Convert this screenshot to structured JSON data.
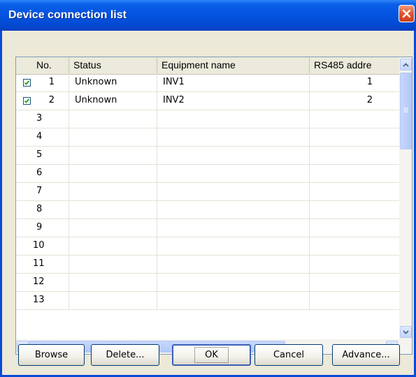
{
  "window": {
    "title": "Device connection list"
  },
  "table": {
    "columns": [
      "No.",
      "Status",
      "Equipment name",
      "RS485 addre"
    ],
    "rows": [
      {
        "no": "1",
        "checked": true,
        "status": "Unknown",
        "name": "INV1",
        "address": "1"
      },
      {
        "no": "2",
        "checked": true,
        "status": "Unknown",
        "name": "INV2",
        "address": "2"
      },
      {
        "no": "3",
        "checked": false,
        "status": "",
        "name": "",
        "address": ""
      },
      {
        "no": "4",
        "checked": false,
        "status": "",
        "name": "",
        "address": ""
      },
      {
        "no": "5",
        "checked": false,
        "status": "",
        "name": "",
        "address": ""
      },
      {
        "no": "6",
        "checked": false,
        "status": "",
        "name": "",
        "address": ""
      },
      {
        "no": "7",
        "checked": false,
        "status": "",
        "name": "",
        "address": ""
      },
      {
        "no": "8",
        "checked": false,
        "status": "",
        "name": "",
        "address": ""
      },
      {
        "no": "9",
        "checked": false,
        "status": "",
        "name": "",
        "address": ""
      },
      {
        "no": "10",
        "checked": false,
        "status": "",
        "name": "",
        "address": ""
      },
      {
        "no": "11",
        "checked": false,
        "status": "",
        "name": "",
        "address": ""
      },
      {
        "no": "12",
        "checked": false,
        "status": "",
        "name": "",
        "address": ""
      },
      {
        "no": "13",
        "checked": false,
        "status": "",
        "name": "",
        "address": ""
      }
    ]
  },
  "buttons": {
    "browse": "Browse",
    "delete": "Delete...",
    "ok": "OK",
    "cancel": "Cancel",
    "advance": "Advance..."
  },
  "icons": {
    "close": "close-icon",
    "scroll_up": "chevron-up-icon",
    "scroll_down": "chevron-down-icon",
    "scroll_left": "chevron-left-icon",
    "scroll_right": "chevron-right-icon",
    "checkbox": "check-icon"
  },
  "colors": {
    "titlebar": "#0453e0",
    "dialog_bg": "#ece9d8",
    "close_button": "#e15b32",
    "scrollbar": "#c3d4fb"
  }
}
